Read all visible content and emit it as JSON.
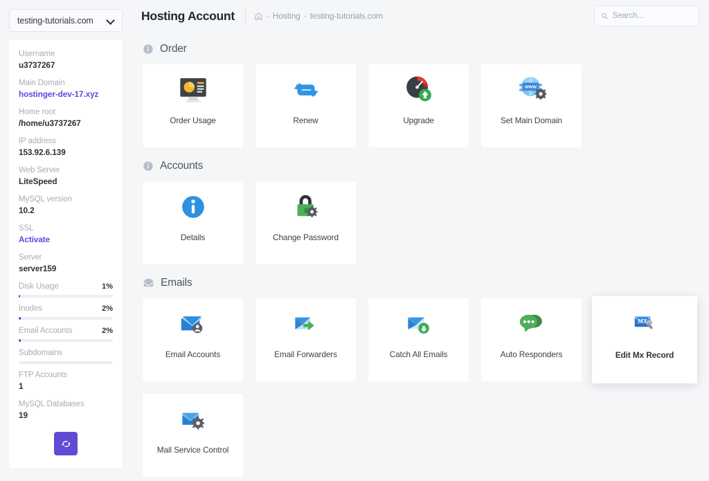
{
  "sidebar": {
    "domain_selector": {
      "value": "testing-tutorials.com",
      "icon": "chevron-down-icon"
    },
    "fields": [
      {
        "label": "Username",
        "value": "u3737267",
        "link": false
      },
      {
        "label": "Main Domain",
        "value": "hostinger-dev-17.xyz",
        "link": true
      },
      {
        "label": "Home root",
        "value": "/home/u3737267",
        "link": false
      },
      {
        "label": "IP address",
        "value": "153.92.6.139",
        "link": false
      },
      {
        "label": "Web Server",
        "value": "LiteSpeed",
        "link": false
      },
      {
        "label": "MySQL version",
        "value": "10.2",
        "link": false
      },
      {
        "label": "SSL",
        "value": "Activate",
        "link": true
      },
      {
        "label": "Server",
        "value": "server159",
        "link": false
      }
    ],
    "meters": [
      {
        "name": "Disk Usage",
        "pct_label": "1%",
        "pct": 1.5
      },
      {
        "name": "Inodes",
        "pct_label": "2%",
        "pct": 2.5
      },
      {
        "name": "Email Accounts",
        "pct_label": "2%",
        "pct": 2.5
      },
      {
        "name": "Subdomains",
        "pct_label": "",
        "pct": 0
      }
    ],
    "counters": [
      {
        "label": "FTP Accounts",
        "value": "1"
      },
      {
        "label": "MySQL Databases",
        "value": "19"
      }
    ],
    "refresh_button": {
      "icon": "refresh-icon",
      "label": ""
    }
  },
  "header": {
    "title": "Hosting Account",
    "breadcrumb": {
      "home_icon": "home-icon",
      "sep": "-",
      "items": [
        "Hosting",
        "testing-tutorials.com"
      ]
    },
    "search": {
      "placeholder": "Search...",
      "value": "",
      "icon": "search-icon"
    }
  },
  "main": {
    "sections": [
      {
        "title": "Order",
        "icon": "info-circle-icon",
        "cards": [
          {
            "label": "Order Usage",
            "icon": "monitor-chart-icon",
            "hover": false
          },
          {
            "label": "Renew",
            "icon": "renew-loop-icon",
            "hover": false
          },
          {
            "label": "Upgrade",
            "icon": "gauge-upgrade-icon",
            "hover": false
          },
          {
            "label": "Set Main Domain",
            "icon": "www-globe-gear-icon",
            "hover": false
          }
        ]
      },
      {
        "title": "Accounts",
        "icon": "info-circle-icon",
        "cards": [
          {
            "label": "Details",
            "icon": "info-blue-circle-icon",
            "hover": false
          },
          {
            "label": "Change Password",
            "icon": "lock-gear-icon",
            "hover": false
          }
        ]
      },
      {
        "title": "Emails",
        "icon": "envelope-icon",
        "cards": [
          {
            "label": "Email Accounts",
            "icon": "mail-user-icon",
            "hover": false
          },
          {
            "label": "Email Forwarders",
            "icon": "mail-forward-icon",
            "hover": false
          },
          {
            "label": "Catch All Emails",
            "icon": "mail-download-icon",
            "hover": false
          },
          {
            "label": "Auto Responders",
            "icon": "chat-bubbles-icon",
            "hover": false
          },
          {
            "label": "Edit Mx Record",
            "icon": "mx-wrench-icon",
            "hover": true
          },
          {
            "label": "Mail Service Control",
            "icon": "mail-gear-icon",
            "hover": false
          }
        ]
      }
    ]
  },
  "colors": {
    "accent_purple": "#5f4bd4",
    "link_purple": "#6247e0",
    "page_bg": "#f5f6f8",
    "card_bg": "#ffffff",
    "text_dark": "#2c3038",
    "text_muted": "#a7acb6"
  }
}
